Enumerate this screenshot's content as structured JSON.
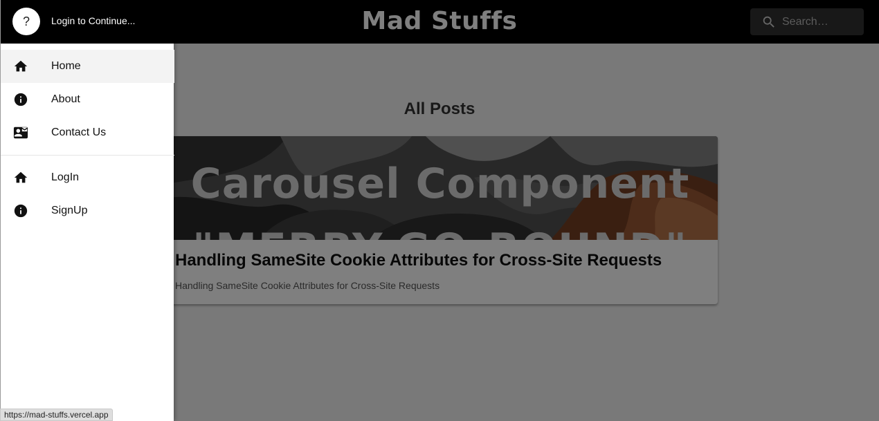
{
  "app": {
    "brand": "Mad Stuffs",
    "search": {
      "placeholder": "Search…",
      "icon": "search-icon"
    }
  },
  "main": {
    "section_title": "All Posts",
    "posts": [
      {
        "image_title": "Carousel Component",
        "image_subtitle": "\"MERRY-GO-ROUND\"",
        "title": "Handling SameSite Cookie Attributes for Cross-Site Requests",
        "description": "Handling SameSite Cookie Attributes for Cross-Site Requests"
      }
    ]
  },
  "drawer": {
    "avatar_text": "?",
    "login_text": "Login to Continue...",
    "primary_items": [
      {
        "label": "Home",
        "icon": "home-icon",
        "active": true
      },
      {
        "label": "About",
        "icon": "info-icon"
      },
      {
        "label": "Contact Us",
        "icon": "contact-card-icon"
      }
    ],
    "secondary_items": [
      {
        "label": "LogIn",
        "icon": "home-icon"
      },
      {
        "label": "SignUp",
        "icon": "info-icon"
      }
    ]
  },
  "status_bar": {
    "url": "https://mad-stuffs.vercel.app"
  },
  "colors": {
    "appbar": "#000000",
    "drawer": "#ffffff",
    "backdrop": "rgba(0,0,0,0.5)",
    "active_item": "#f3f3f3"
  }
}
